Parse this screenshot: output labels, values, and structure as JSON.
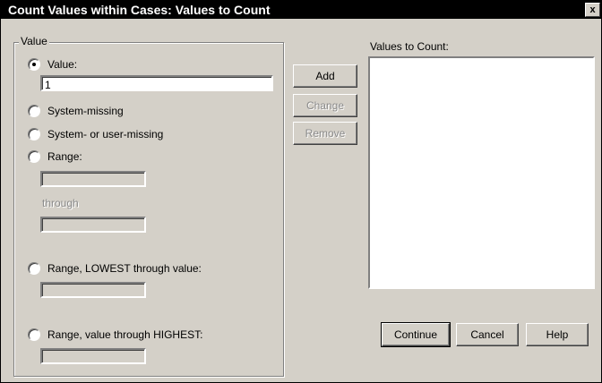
{
  "window": {
    "title": "Count Values within Cases: Values to Count",
    "close": "x"
  },
  "value_group": {
    "label": "Value",
    "value_option": {
      "label": "Value:",
      "selected": true
    },
    "value_input": "1",
    "system_missing": {
      "label": "System-missing",
      "selected": false
    },
    "system_or_user_missing": {
      "label": "System- or user-missing",
      "selected": false
    },
    "range": {
      "label": "Range:",
      "selected": false,
      "through_label": "through"
    },
    "range_lowest": {
      "label": "Range, LOWEST through value:",
      "selected": false
    },
    "range_highest": {
      "label": "Range, value through HIGHEST:",
      "selected": false
    }
  },
  "buttons": {
    "add": "Add",
    "change": "Change",
    "remove": "Remove",
    "continue": "Continue",
    "cancel": "Cancel",
    "help": "Help"
  },
  "values_to_count": {
    "label": "Values to Count:",
    "items": []
  }
}
